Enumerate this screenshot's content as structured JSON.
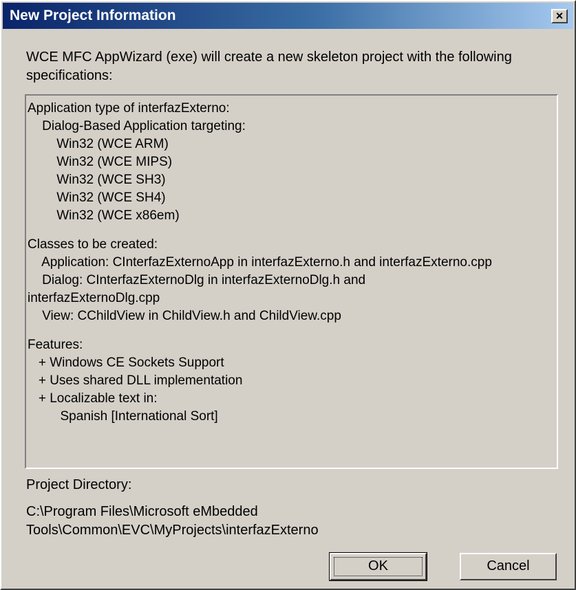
{
  "window": {
    "title": "New Project Information",
    "close_glyph": "×"
  },
  "intro_text": "WCE MFC AppWizard (exe) will create a new skeleton project with the following specifications:",
  "specifications": {
    "lines": [
      "Application type of interfazExterno:",
      "    Dialog-Based Application targeting:",
      "        Win32 (WCE ARM)",
      "        Win32 (WCE MIPS)",
      "        Win32 (WCE SH3)",
      "        Win32 (WCE SH4)",
      "        Win32 (WCE x86em)",
      "",
      "Classes to be created:",
      "    Application: CInterfazExternoApp in interfazExterno.h and interfazExterno.cpp",
      "    Dialog: CInterfazExternoDlg in interfazExternoDlg.h and",
      "interfazExternoDlg.cpp",
      "    View: CChildView in ChildView.h and ChildView.cpp",
      "",
      "Features:",
      "   + Windows CE Sockets Support",
      "   + Uses shared DLL implementation",
      "   + Localizable text in:",
      "         Spanish [International Sort]"
    ]
  },
  "project_directory": {
    "label": "Project Directory:",
    "path": "C:\\Program Files\\Microsoft eMbedded Tools\\Common\\EVC\\MyProjects\\interfazExterno"
  },
  "buttons": {
    "ok": "OK",
    "cancel": "Cancel"
  }
}
